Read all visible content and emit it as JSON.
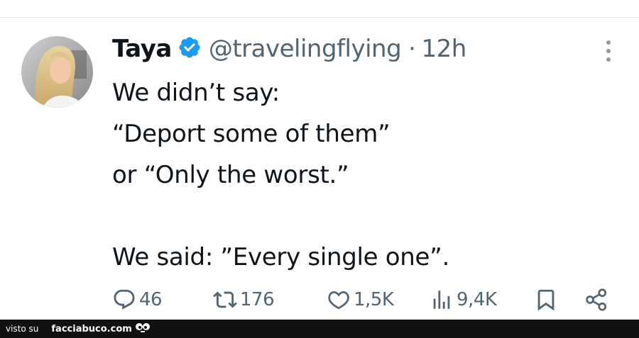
{
  "tweet": {
    "author": {
      "display_name": "Taya",
      "handle": "@travelingflying",
      "verified": true,
      "separator": "·",
      "time": "12h"
    },
    "text_lines": [
      "We didn’t say:",
      "“Deport some of them”",
      "or “Only the worst.”",
      "",
      "We said: ”Every single one”."
    ],
    "actions": {
      "replies": "46",
      "retweets": "176",
      "likes": "1,5K",
      "views": "9,4K"
    }
  },
  "footer": {
    "visto_su": "visto su",
    "brand": "facciabuco.com"
  },
  "colors": {
    "text": "#0f1419",
    "secondary": "#536471",
    "verified_blue": "#1d9bf0",
    "footer_bg": "#111111"
  },
  "icons": [
    "verified-badge-icon",
    "more-icon",
    "reply-icon",
    "retweet-icon",
    "like-icon",
    "views-icon",
    "bookmark-icon",
    "share-icon"
  ]
}
